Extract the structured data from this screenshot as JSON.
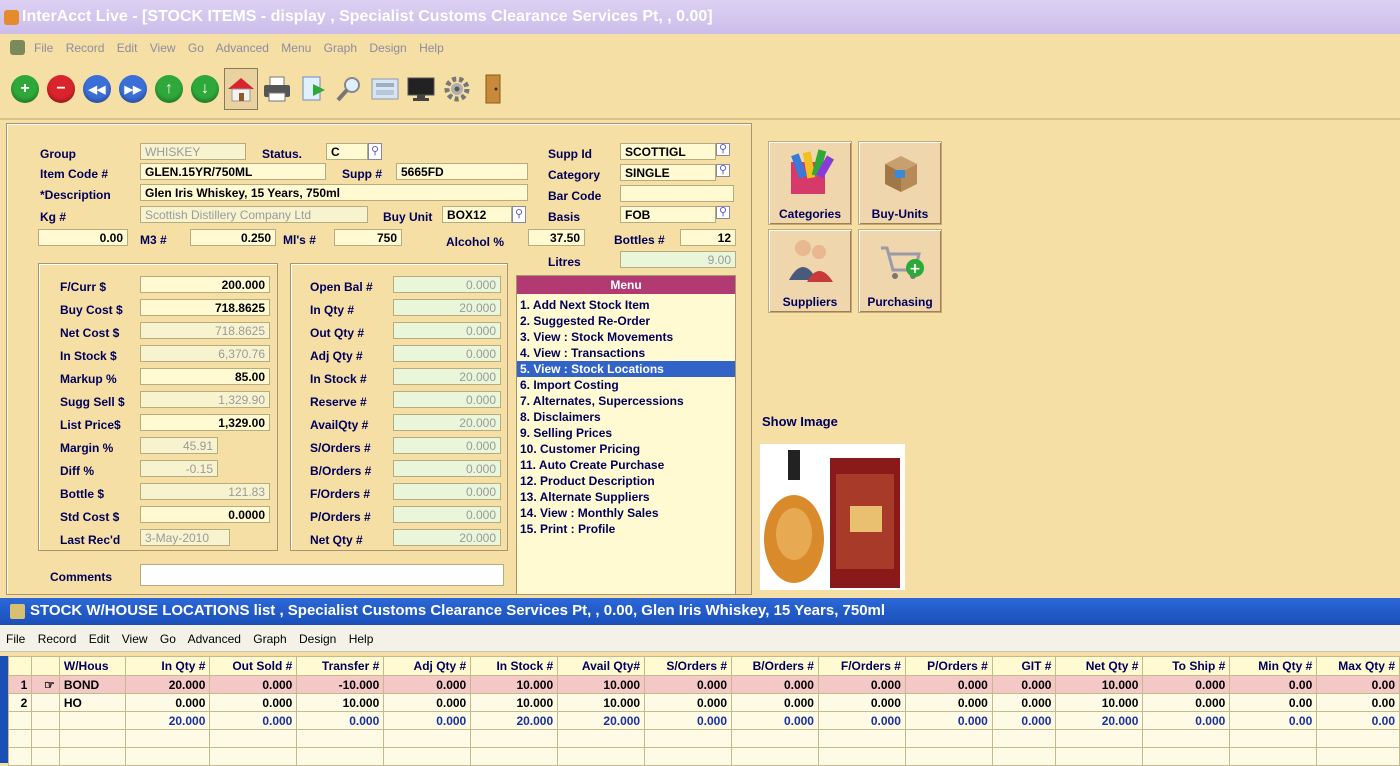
{
  "window": {
    "title": "InterAcct Live - [STOCK ITEMS - display , Specialist Customs Clearance Services Pt, , 0.00]"
  },
  "menubar": [
    "File",
    "Record",
    "Edit",
    "View",
    "Go",
    "Advanced",
    "Menu",
    "Graph",
    "Design",
    "Help"
  ],
  "toolbar": [
    {
      "name": "add",
      "icon": "add-icon",
      "color": "#2fa83a",
      "glyph": "+"
    },
    {
      "name": "delete",
      "icon": "delete-icon",
      "color": "#d8242a",
      "glyph": "−"
    },
    {
      "name": "first",
      "icon": "first-icon",
      "color": "#3a6fd8",
      "glyph": "⏮"
    },
    {
      "name": "last",
      "icon": "last-icon",
      "color": "#3a6fd8",
      "glyph": "⏭"
    },
    {
      "name": "previous",
      "icon": "up-arrow-icon",
      "color": "#2fa83a",
      "glyph": "↑"
    },
    {
      "name": "next",
      "icon": "down-arrow-icon",
      "color": "#2fa83a",
      "glyph": "↓"
    },
    {
      "name": "home",
      "icon": "home-icon"
    },
    {
      "name": "print",
      "icon": "printer-icon"
    },
    {
      "name": "export",
      "icon": "export-icon"
    },
    {
      "name": "search",
      "icon": "magnifier-icon"
    },
    {
      "name": "calculator",
      "icon": "calculator-icon"
    },
    {
      "name": "monitor",
      "icon": "monitor-icon"
    },
    {
      "name": "settings",
      "icon": "gear-icon"
    },
    {
      "name": "exit",
      "icon": "door-icon"
    }
  ],
  "header": {
    "group_label": "Group",
    "group": "WHISKEY",
    "status_label": "Status.",
    "status": "C",
    "item_code_label": "Item Code #",
    "item_code": "GLEN.15YR/750ML",
    "supp_no_label": "Supp #",
    "supp_no": "5665FD",
    "description_label": "*Description",
    "description": "Glen Iris Whiskey, 15 Years, 750ml",
    "kg_label": "Kg #",
    "kg": "0.00",
    "supplier_name": "Scottish Distillery Company Ltd",
    "buy_unit_label": "Buy Unit",
    "buy_unit": "BOX12",
    "m3_label": "M3 #",
    "m3": "0.250",
    "mls_label": "Ml's #",
    "mls": "750",
    "alcohol_label": "Alcohol %",
    "alcohol": "37.50",
    "supp_id_label": "Supp Id",
    "supp_id": "SCOTTIGL",
    "category_label": "Category",
    "category": "SINGLE",
    "bar_code_label": "Bar Code",
    "bar_code": "",
    "basis_label": "Basis",
    "basis": "FOB",
    "bottles_label": "Bottles #",
    "bottles": "12",
    "litres_label": "Litres",
    "litres": "9.00"
  },
  "costs": {
    "fcurr_label": "F/Curr $",
    "fcurr": "200.000",
    "buy_cost_label": "Buy Cost $",
    "buy_cost": "718.8625",
    "net_cost_label": "Net Cost  $",
    "net_cost": "718.8625",
    "in_stock_label": "In Stock  $",
    "in_stock": "6,370.76",
    "markup_label": "Markup %",
    "markup": "85.00",
    "sugg_sell_label": "Sugg Sell $",
    "sugg_sell": "1,329.90",
    "list_price_label": "List Price$",
    "list_price": "1,329.00",
    "margin_label": "Margin %",
    "margin": "45.91",
    "diff_label": "Diff %",
    "diff": "-0.15",
    "bottle_label": "Bottle $",
    "bottle": "121.83",
    "std_cost_label": "Std Cost $",
    "std_cost": "0.0000",
    "last_recd_label": "Last Rec'd",
    "last_recd": "3-May-2010"
  },
  "quantities": {
    "open_bal_label": "Open Bal #",
    "open_bal": "0.000",
    "in_qty_label": "In  Qty  #",
    "in_qty": "20.000",
    "out_qty_label": "Out Qty  #",
    "out_qty": "0.000",
    "adj_qty_label": "Adj Qty  #",
    "adj_qty": "0.000",
    "in_stock_label": "In Stock #",
    "in_stock": "20.000",
    "reserve_label": "Reserve  #",
    "reserve": "0.000",
    "avail_qty_label": "AvailQty #",
    "avail_qty": "20.000",
    "sorders_label": "S/Orders #",
    "sorders": "0.000",
    "borders_label": "B/Orders #",
    "borders": "0.000",
    "forders_label": "F/Orders #",
    "forders": "0.000",
    "porders_label": "P/Orders #",
    "porders": "0.000",
    "net_qty_label": "Net Qty  #",
    "net_qty": "20.000"
  },
  "comments_label": "Comments",
  "menu": {
    "title": "Menu",
    "items": [
      "1. Add Next Stock Item",
      "2. Suggested Re-Order",
      "3. View : Stock Movements",
      "4. View : Transactions",
      "5. View : Stock Locations",
      "6. Import Costing",
      "7. Alternates, Supercessions",
      "8. Disclaimers",
      "9. Selling Prices",
      "10. Customer Pricing",
      "11. Auto Create Purchase",
      "12. Product Description",
      "13. Alternate Suppliers",
      "14. View : Monthly Sales",
      "15. Print : Profile"
    ],
    "selected_index": 4
  },
  "side_buttons": {
    "categories": "Categories",
    "buy_units": "Buy-Units",
    "suppliers": "Suppliers",
    "purchasing": "Purchasing"
  },
  "show_image_label": "Show Image",
  "locations": {
    "title": "STOCK W/HOUSE LOCATIONS list , Specialist Customs Clearance Services Pt, , 0.00, Glen Iris Whiskey, 15 Years, 750ml",
    "menubar": [
      "File",
      "Record",
      "Edit",
      "View",
      "Go",
      "Advanced",
      "Graph",
      "Design",
      "Help"
    ],
    "columns": [
      "",
      "",
      "W/Hous",
      "In Qty #",
      "Out Sold #",
      "Transfer #",
      "Adj Qty #",
      "In Stock #",
      "Avail Qty#",
      "S/Orders #",
      "B/Orders #",
      "F/Orders #",
      "P/Orders #",
      "GIT #",
      "Net Qty #",
      "To Ship #",
      "Min Qty #",
      "Max Qty #"
    ],
    "rows": [
      [
        "1",
        "☞",
        "BOND",
        "20.000",
        "0.000",
        "-10.000",
        "0.000",
        "10.000",
        "10.000",
        "0.000",
        "0.000",
        "0.000",
        "0.000",
        "0.000",
        "10.000",
        "0.000",
        "0.00",
        "0.00"
      ],
      [
        "2",
        "",
        "HO",
        "0.000",
        "0.000",
        "10.000",
        "0.000",
        "10.000",
        "10.000",
        "0.000",
        "0.000",
        "0.000",
        "0.000",
        "0.000",
        "10.000",
        "0.000",
        "0.00",
        "0.00"
      ]
    ],
    "totals": [
      "",
      "",
      "",
      "20.000",
      "0.000",
      "0.000",
      "0.000",
      "20.000",
      "20.000",
      "0.000",
      "0.000",
      "0.000",
      "0.000",
      "0.000",
      "20.000",
      "0.000",
      "0.00",
      "0.00"
    ]
  },
  "colors": {
    "background": "#f5dfa5",
    "field": "#fffad2",
    "label": "#00005a",
    "menu_header": "#b23a73",
    "selected": "#3264c8",
    "title_bar": "#1a4fb8"
  }
}
